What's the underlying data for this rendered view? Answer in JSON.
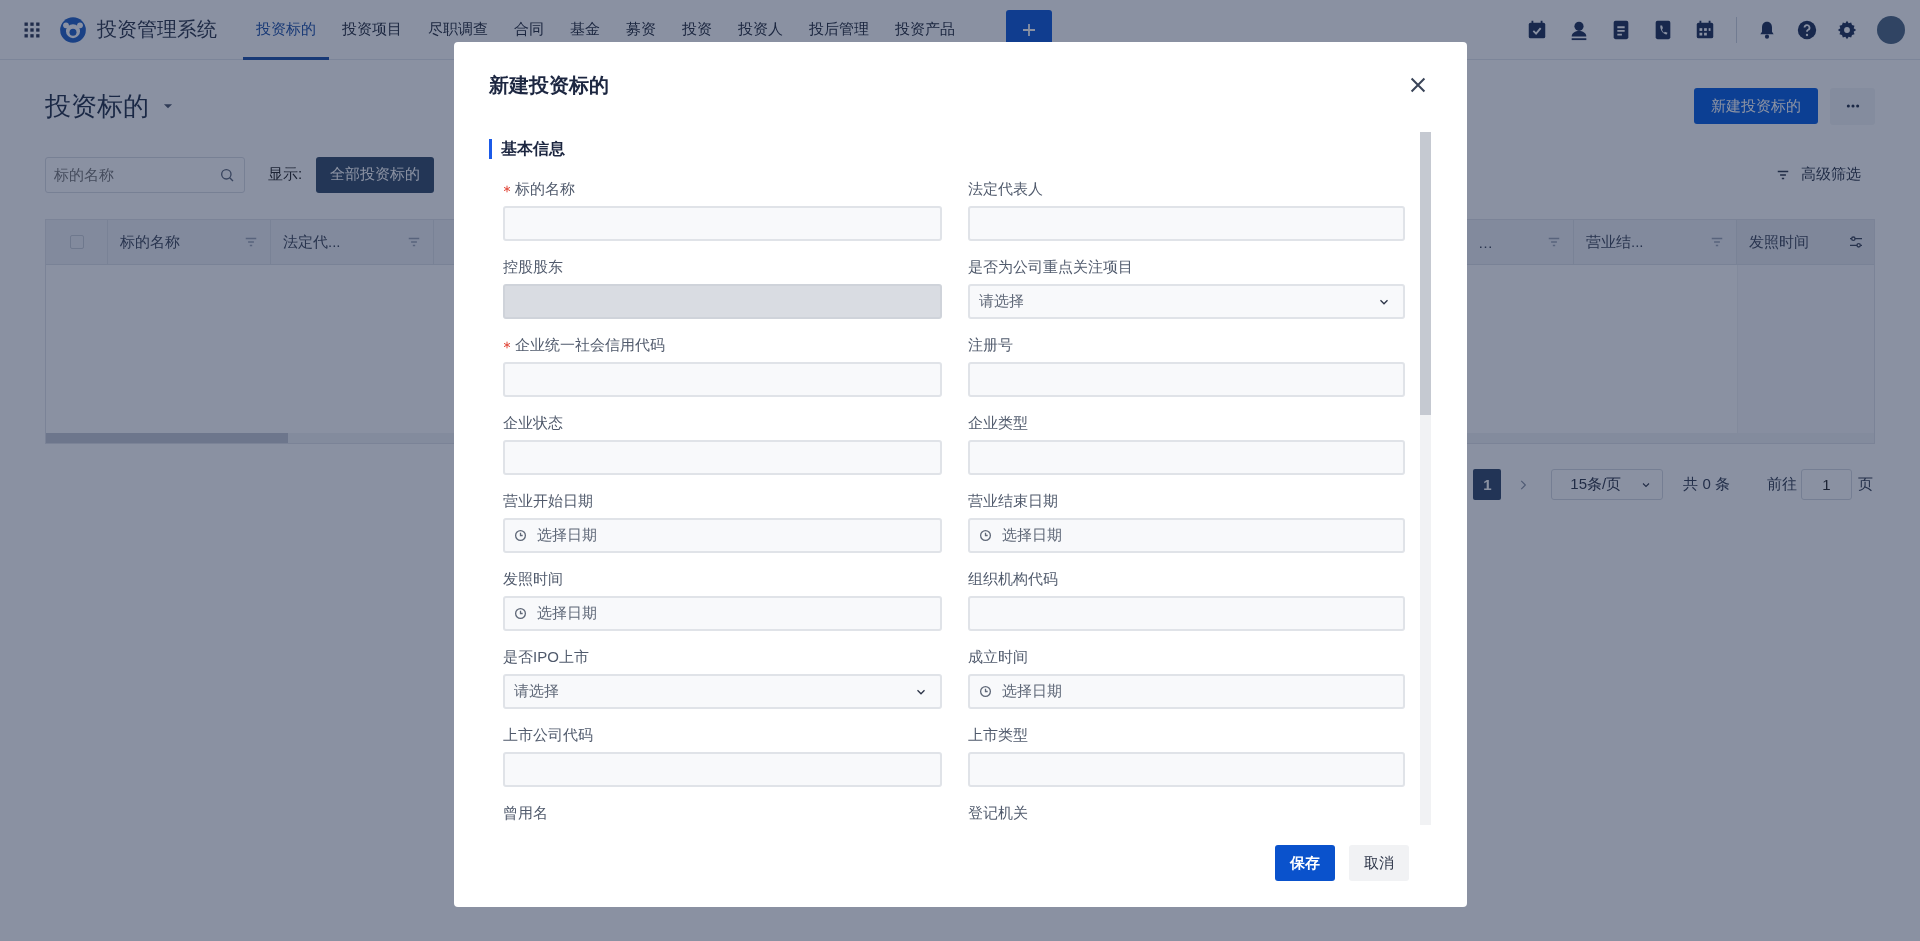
{
  "nav": {
    "app_title": "投资管理系统",
    "tabs": [
      {
        "label": "投资标的",
        "selected": true
      },
      {
        "label": "投资项目",
        "selected": false
      },
      {
        "label": "尽职调查",
        "selected": false
      },
      {
        "label": "合同",
        "selected": false
      },
      {
        "label": "基金",
        "selected": false
      },
      {
        "label": "募资",
        "selected": false
      },
      {
        "label": "投资",
        "selected": false
      },
      {
        "label": "投资人",
        "selected": false
      },
      {
        "label": "投后管理",
        "selected": false
      },
      {
        "label": "投资产品",
        "selected": false
      }
    ]
  },
  "page": {
    "title": "投资标的",
    "new_button": "新建投资标的",
    "search": {
      "placeholder": "标的名称"
    },
    "display_label": "显示:",
    "display_chip": "全部投资标的",
    "advanced_filter": "高级筛选"
  },
  "table": {
    "select_all": {
      "checked": false
    },
    "columns": [
      {
        "label": "标的名称",
        "filterable": true
      },
      {
        "label": "法定代...",
        "filterable": true
      },
      {
        "label": "…",
        "filterable": true
      },
      {
        "label": "营业结...",
        "filterable": true
      },
      {
        "label": "发照时间",
        "filterable": false
      }
    ]
  },
  "pagination": {
    "current": "1",
    "page_size": "15条/页",
    "total": "共 0 条",
    "goto_label": "前往",
    "goto_value": "1",
    "page_suffix": "页"
  },
  "modal": {
    "title": "新建投资标的",
    "section": "基本信息",
    "fields": [
      {
        "label": "标的名称",
        "required": true,
        "kind": "text",
        "disabled": false
      },
      {
        "label": "法定代表人",
        "required": false,
        "kind": "text",
        "disabled": false
      },
      {
        "label": "控股股东",
        "required": false,
        "kind": "text",
        "disabled": true
      },
      {
        "label": "是否为公司重点关注项目",
        "required": false,
        "kind": "select",
        "disabled": false,
        "placeholder": "请选择"
      },
      {
        "label": "企业统一社会信用代码",
        "required": true,
        "kind": "text",
        "disabled": false
      },
      {
        "label": "注册号",
        "required": false,
        "kind": "text",
        "disabled": false
      },
      {
        "label": "企业状态",
        "required": false,
        "kind": "text",
        "disabled": false
      },
      {
        "label": "企业类型",
        "required": false,
        "kind": "text",
        "disabled": false
      },
      {
        "label": "营业开始日期",
        "required": false,
        "kind": "date",
        "disabled": false,
        "placeholder": "选择日期"
      },
      {
        "label": "营业结束日期",
        "required": false,
        "kind": "date",
        "disabled": false,
        "placeholder": "选择日期"
      },
      {
        "label": "发照时间",
        "required": false,
        "kind": "date",
        "disabled": false,
        "placeholder": "选择日期"
      },
      {
        "label": "组织机构代码",
        "required": false,
        "kind": "text",
        "disabled": false
      },
      {
        "label": "是否IPO上市",
        "required": false,
        "kind": "select",
        "disabled": false,
        "placeholder": "请选择"
      },
      {
        "label": "成立时间",
        "required": false,
        "kind": "date",
        "disabled": false,
        "placeholder": "选择日期"
      },
      {
        "label": "上市公司代码",
        "required": false,
        "kind": "text",
        "disabled": false
      },
      {
        "label": "上市类型",
        "required": false,
        "kind": "text",
        "disabled": false
      },
      {
        "label": "曾用名",
        "required": false
      },
      {
        "label": "登记机关",
        "required": false
      }
    ],
    "buttons": [
      {
        "label": "保存",
        "kind": "primary"
      },
      {
        "label": "取消",
        "kind": "secondary"
      }
    ]
  }
}
